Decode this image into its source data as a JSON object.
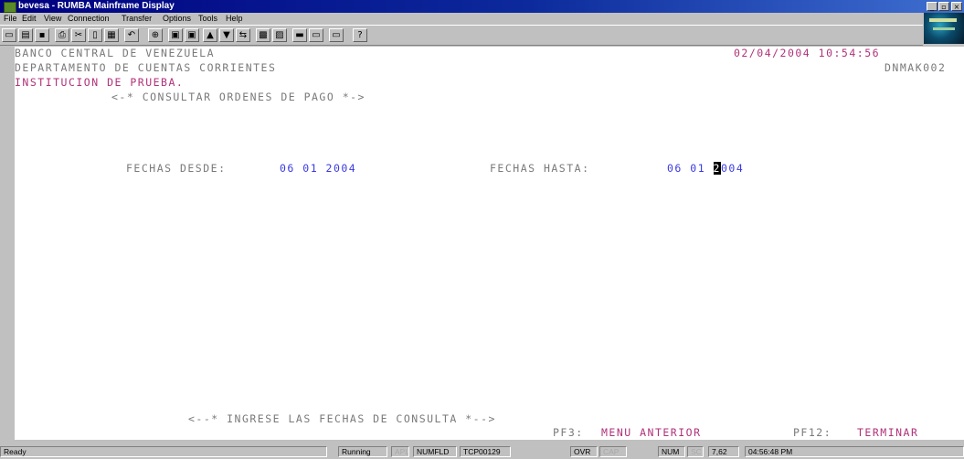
{
  "window": {
    "title": "bevesa - RUMBA Mainframe Display",
    "controls": [
      "_",
      "▫",
      "×"
    ]
  },
  "menu": [
    "File",
    "Edit",
    "View",
    "Connection",
    "Transfer",
    "Options",
    "Tools",
    "Help"
  ],
  "toolbar": [
    {
      "icon": "new-icon",
      "glyph": "▭"
    },
    {
      "icon": "open-icon",
      "glyph": "▤"
    },
    {
      "icon": "save-icon",
      "glyph": "▪"
    },
    {
      "icon": "print-icon",
      "glyph": "⎙"
    },
    {
      "icon": "cut-icon",
      "glyph": "✂"
    },
    {
      "icon": "copy-icon",
      "glyph": "▯"
    },
    {
      "icon": "paste-icon",
      "glyph": "▦"
    },
    {
      "icon": "undo-icon",
      "glyph": "↶"
    },
    {
      "icon": "connect-icon",
      "glyph": "⊕"
    },
    {
      "icon": "session-icon",
      "glyph": "▣"
    },
    {
      "icon": "session-alt-icon",
      "glyph": "▣"
    },
    {
      "icon": "send-file-icon",
      "glyph": "▲"
    },
    {
      "icon": "receive-file-icon",
      "glyph": "▼"
    },
    {
      "icon": "transfer-icon",
      "glyph": "⇆"
    },
    {
      "icon": "keyboard-map-icon",
      "glyph": "▩"
    },
    {
      "icon": "macro-icon",
      "glyph": "▨"
    },
    {
      "icon": "hotspot-icon",
      "glyph": "▬"
    },
    {
      "icon": "display-icon",
      "glyph": "▭"
    },
    {
      "icon": "terminal-icon",
      "glyph": "▭"
    },
    {
      "icon": "help-icon",
      "glyph": "?"
    }
  ],
  "screen": {
    "line1_left": "BANCO CENTRAL DE VENEZUELA",
    "line1_right": "02/04/2004 10:54:56",
    "line2_left": "DEPARTAMENTO DE CUENTAS CORRIENTES",
    "line2_right": "DNMAK002",
    "line3": "INSTITUCION DE PRUEBA.",
    "line4": "<-* CONSULTAR ORDENES DE PAGO *->",
    "fechas_desde_label": "FECHAS DESDE:",
    "fechas_desde_value": "06 01 2004",
    "fechas_hasta_label": "FECHAS HASTA:",
    "fechas_hasta_value_pre": "06 01 ",
    "fechas_hasta_cursor": "2",
    "fechas_hasta_value_post": "004",
    "prompt": "<--* INGRESE LAS FECHAS DE CONSULTA *-->",
    "pf3_key": "PF3:",
    "pf3_label": "MENU ANTERIOR",
    "pf12_key": "PF12:",
    "pf12_label": "TERMINAR"
  },
  "statusbar": {
    "ready": "Ready",
    "running": "Running",
    "apl": "APL",
    "numfld": "NUMFLD",
    "tcp": "TCP00129",
    "ovr": "OVR",
    "cap": "CAP",
    "num": "NUM",
    "scrl": "SC",
    "cursor_pos": "7,62",
    "time": "04:56:48 PM"
  }
}
